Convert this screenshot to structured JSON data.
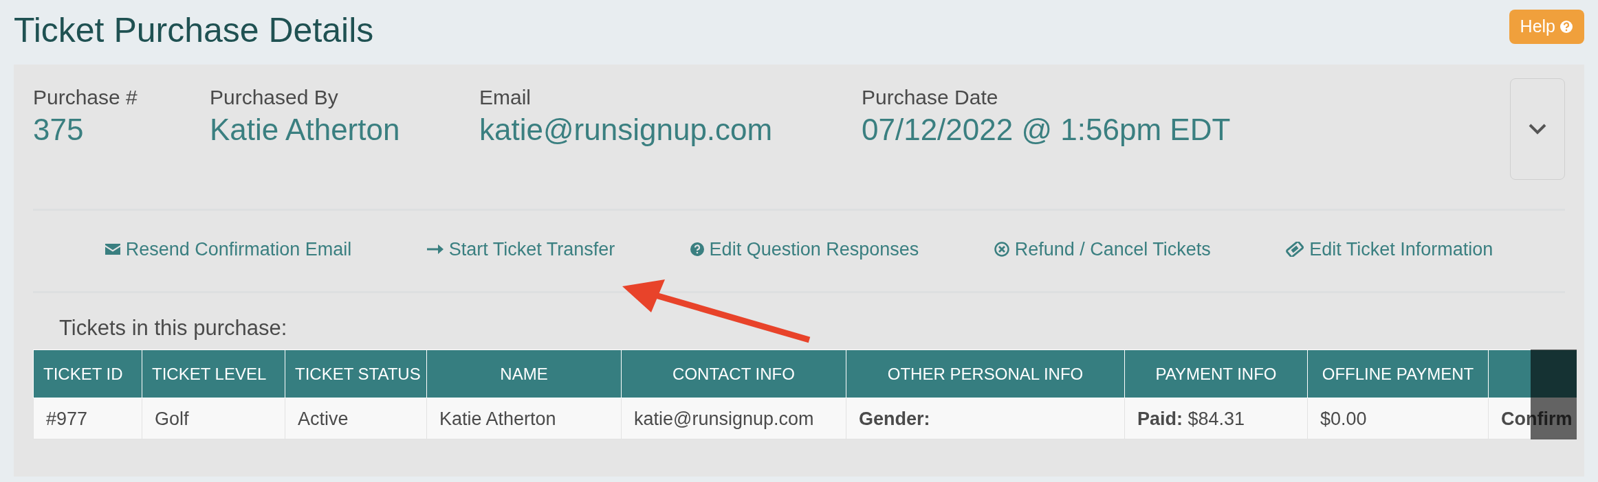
{
  "page_title": "Ticket Purchase Details",
  "help_button": {
    "label": "Help"
  },
  "summary": [
    {
      "label": "Purchase #",
      "value": "375"
    },
    {
      "label": "Purchased By",
      "value": "Katie Atherton"
    },
    {
      "label": "Email",
      "value": "katie@runsignup.com"
    },
    {
      "label": "Purchase Date",
      "value": "07/12/2022 @ 1:56pm EDT"
    }
  ],
  "details_expanded": false,
  "actions": [
    {
      "label": "Resend Confirmation Email"
    },
    {
      "label": "Start Ticket Transfer"
    },
    {
      "label": "Edit Question Responses"
    },
    {
      "label": "Refund / Cancel Tickets"
    },
    {
      "label": "Edit Ticket Information"
    }
  ],
  "tickets_heading": "Tickets in this purchase:",
  "table": {
    "columns": [
      "TICKET ID",
      "TICKET LEVEL",
      "TICKET STATUS",
      "NAME",
      "CONTACT INFO",
      "OTHER PERSONAL INFO",
      "PAYMENT INFO",
      "OFFLINE PAYMENT",
      ""
    ],
    "rows": [
      {
        "cells": [
          "#977",
          "Golf",
          "Active",
          "Katie Atherton",
          "katie@runsignup.com",
          "**Gender:**",
          "**Paid:** $84.31",
          "$0.00",
          "**Confirm**"
        ]
      }
    ]
  }
}
